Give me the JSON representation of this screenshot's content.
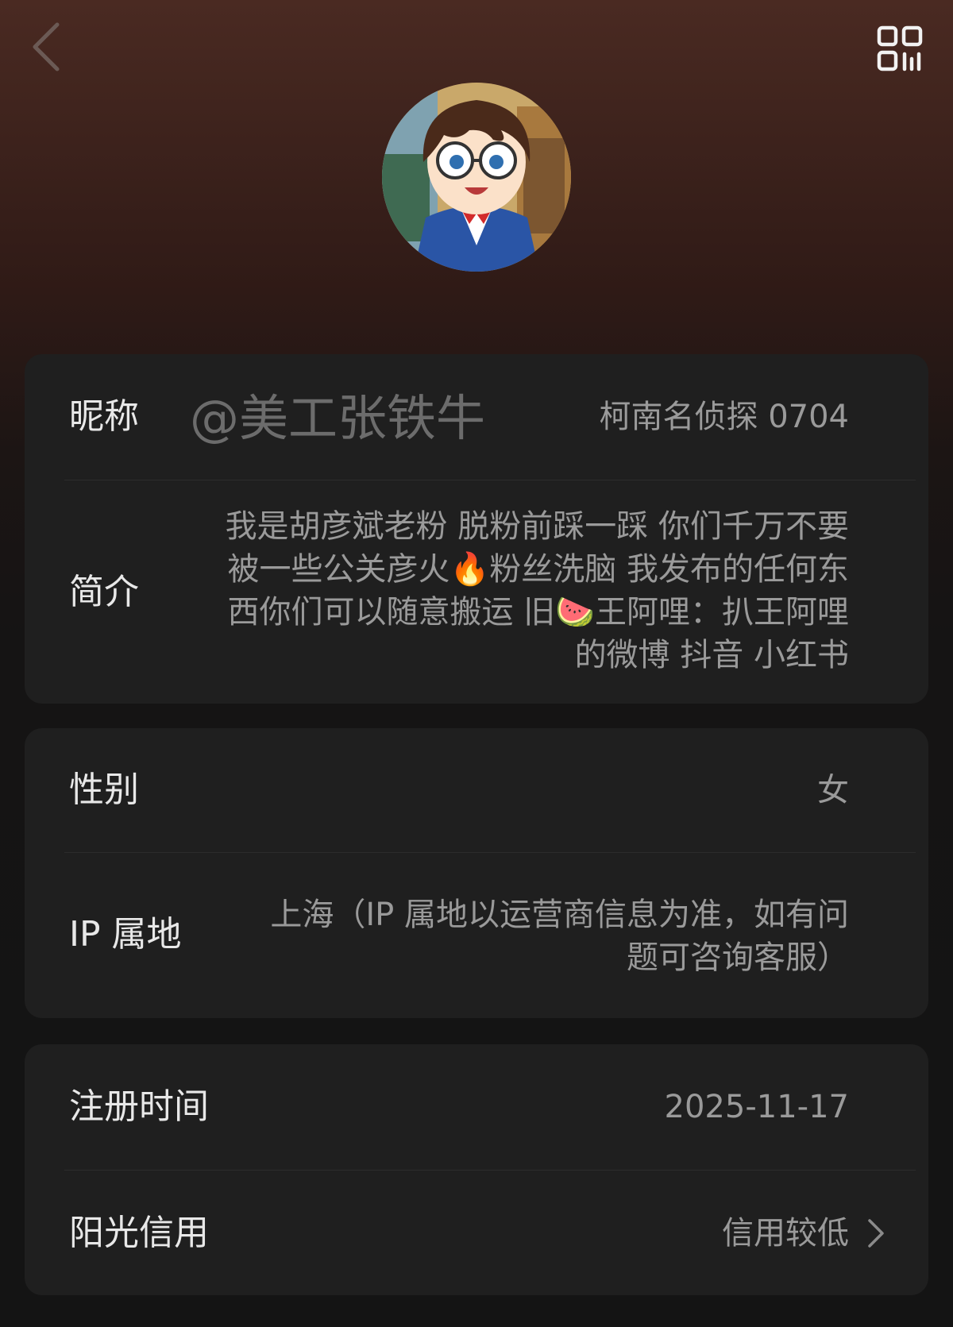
{
  "header": {
    "back_icon": "chevron-left-icon",
    "qr_icon": "qr-code-icon",
    "avatar": "anime-boy-avatar"
  },
  "profile": {
    "nickname": {
      "label": "昵称",
      "watermark": "@美工张铁牛",
      "value": "柯南名侦探 0704"
    },
    "bio": {
      "label": "简介",
      "value": "我是胡彦斌老粉 脱粉前踩一踩 你们千万不要被一些公关彦火🔥粉丝洗脑 我发布的任何东西你们可以随意搬运 旧🍉王阿哩：扒王阿哩的微博 抖音 小红书"
    },
    "gender": {
      "label": "性别",
      "value": "女"
    },
    "ip": {
      "label": "IP 属地",
      "value": "上海（IP 属地以运营商信息为准，如有问题可咨询客服）"
    },
    "register": {
      "label": "注册时间",
      "value": "2025-11-17"
    },
    "credit": {
      "label": "阳光信用",
      "value": "信用较低",
      "icon": "chevron-right-icon"
    }
  },
  "colors": {
    "background": "#141414",
    "card": "#1f1f1f",
    "label": "#e8e8e8",
    "value": "#9a9a9a"
  }
}
